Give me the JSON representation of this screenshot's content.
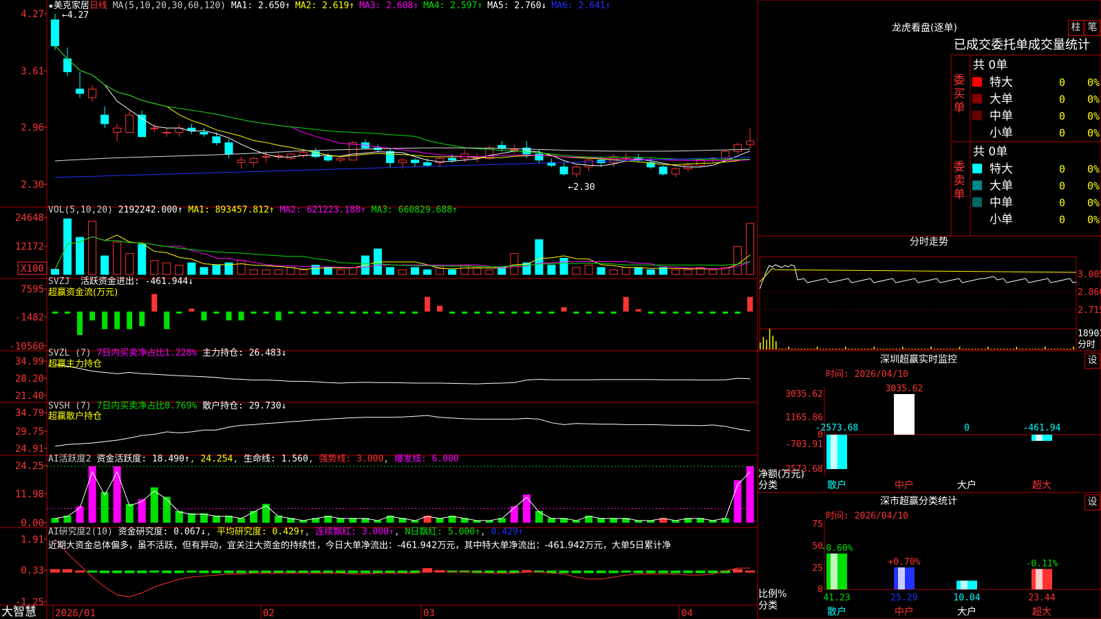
{
  "colors": {
    "up": "#ff3333",
    "down": "#00ffff",
    "grid": "#b00000",
    "yellow": "#ffff00",
    "magenta": "#ff00ff",
    "green": "#00e000",
    "white": "#ffffff",
    "blue": "#2233ff"
  },
  "stock": {
    "name": "美克家居",
    "period": "日线",
    "ma_set": "MA(5,10,20,30,60,120)"
  },
  "header_ma": [
    {
      "label": "MA1:",
      "value": "2.650↑",
      "color": "#ffffff"
    },
    {
      "label": "MA2:",
      "value": "2.619↑",
      "color": "#ffff00"
    },
    {
      "label": "MA3:",
      "value": "2.608↑",
      "color": "#ff00ff"
    },
    {
      "label": "MA4:",
      "value": "2.597↑",
      "color": "#00e000"
    },
    {
      "label": "MA5:",
      "value": "2.760↓",
      "color": "#ffffff"
    },
    {
      "label": "MA6:",
      "value": "2.641↑",
      "color": "#2233ff"
    }
  ],
  "price_axis": [
    "4.27",
    "3.61",
    "2.96",
    "2.30"
  ],
  "price_marks": {
    "high": "4.27",
    "low": "2.30"
  },
  "vol": {
    "title": "VOL(5,10,20)",
    "value": "2192242.000↑",
    "ma1": "MA1: 893457.812↑",
    "ma2": "MA2: 621223.188↑",
    "ma3": "MA3: 660829.688↑",
    "axis": [
      "24648",
      "12172"
    ],
    "unit": "X100"
  },
  "svzj": {
    "title": "SVZJ",
    "line": "活跃资金进出: -461.944↓",
    "sub": "超赢资金流(万元)",
    "axis": [
      "7595",
      "-1482",
      "-10560"
    ]
  },
  "svzl": {
    "title": "SVZL (7)",
    "pct": "7日内买卖净占比1.228%",
    "line": "主力持仓: 26.483↓",
    "sub": "超赢主力持仓",
    "axis": [
      "34.99",
      "28.20",
      "21.40"
    ]
  },
  "svsh": {
    "title": "SVSH (7)",
    "pct": "7日内买卖净占比0.769%",
    "line": "散户持仓: 29.730↓",
    "sub": "超赢散户持仓",
    "axis": [
      "34.79",
      "29.75",
      "24.91"
    ]
  },
  "ai1": {
    "title": "AI活跃度2",
    "a": "资金活跃度: 18.490↑",
    "b": "24.254",
    "c": "生命线: 1.560",
    "d": "强势线: 3.000",
    "e": "爆发线: 6.000",
    "axis": [
      "24.25",
      "11.98",
      "0.00"
    ]
  },
  "ai2": {
    "title": "AI研究度2(10)",
    "a": "资金研究度: 0.067↓",
    "b": "平均研究度: 0.429↑",
    "c": "连续飘红: 3.000↑",
    "d": "N日飘红: 5.000↑",
    "e": "0.429↑",
    "axis": [
      "1.91",
      "0.33",
      "-1.25"
    ],
    "comment": "近期大资金总体偏多，虽不活跃，但有异动，宜关注大资金的持续性，今日大单净流出：-461.942万元，其中特大单净流出：-461.942万元，大单5日累计净"
  },
  "time_axis": [
    "2026/01",
    "02",
    "03",
    "04"
  ],
  "brand": "大智慧",
  "dragon": {
    "title": "龙虎看盘(逐单)",
    "btn1": "柱",
    "btn2": "笔",
    "subtitle": "已成交委托单成交量统计",
    "buy": {
      "label": "委买单",
      "total": "共 0单",
      "rows": [
        {
          "name": "特大",
          "v": "0",
          "p": "0%",
          "c": "#ff0000"
        },
        {
          "name": "大单",
          "v": "0",
          "p": "0%",
          "c": "#880000"
        },
        {
          "name": "中单",
          "v": "0",
          "p": "0%",
          "c": "#660000"
        },
        {
          "name": "小单",
          "v": "0",
          "p": "0%",
          "c": ""
        }
      ]
    },
    "sell": {
      "label": "委卖单",
      "total": "共 0单",
      "rows": [
        {
          "name": "特大",
          "v": "0",
          "p": "0%",
          "c": "#00ffff"
        },
        {
          "name": "大单",
          "v": "0",
          "p": "0%",
          "c": "#008888"
        },
        {
          "name": "中单",
          "v": "0",
          "p": "0%",
          "c": "#006666"
        },
        {
          "name": "小单",
          "v": "0",
          "p": "0%",
          "c": ""
        }
      ]
    }
  },
  "minute": {
    "title": "分时走势",
    "axis": [
      "3.005",
      "2.860",
      "2.715"
    ],
    "vol_axis": [
      "18901",
      "分时"
    ]
  },
  "sz_monitor": {
    "title": "深圳超赢实时监控",
    "btn": "设",
    "time": "时间: 2026/04/10",
    "axis": [
      "3035.62",
      "1165.86",
      "0",
      "-703.91",
      "-2573.68"
    ],
    "ylabel": "净额(万元)",
    "xlabel": "分类",
    "cats": [
      "散户",
      "中户",
      "大户",
      "超大"
    ],
    "values": [
      "-2573.68",
      "3035.62",
      "0",
      "-461.94"
    ]
  },
  "sz_class": {
    "title": "深市超赢分类统计",
    "btn": "设",
    "time": "时间: 2026/04/10",
    "axis": [
      "75",
      "50",
      "25",
      "0"
    ],
    "ylabel": "比例%",
    "xlabel": "分类",
    "cats": [
      "散户",
      "中户",
      "大户",
      "超大"
    ],
    "values": [
      "41.23",
      "25.29",
      "10.04",
      "23.44"
    ],
    "changes": [
      "-0.60%",
      "+0.70%",
      "",
      "-0.11%"
    ]
  },
  "chart_data": [
    {
      "type": "candlestick",
      "title": "美克家居 日线",
      "series": "MA(5,10,20,30,60,120)",
      "x": [
        "2026/01",
        "02",
        "03",
        "04"
      ],
      "ylim": [
        2.3,
        4.27
      ],
      "high": 4.27,
      "low": 2.3,
      "ohlc_approx": [
        [
          4.2,
          4.27,
          3.85,
          3.9
        ],
        [
          3.75,
          3.88,
          3.55,
          3.6
        ],
        [
          3.4,
          3.6,
          3.3,
          3.35
        ],
        [
          3.3,
          3.45,
          3.25,
          3.4
        ],
        [
          3.1,
          3.2,
          2.95,
          3.0
        ],
        [
          2.9,
          3.0,
          2.8,
          2.95
        ],
        [
          2.9,
          3.15,
          2.9,
          3.1
        ],
        [
          3.1,
          3.15,
          2.85,
          2.85
        ],
        [
          2.95,
          3.0,
          2.9,
          2.95
        ],
        [
          2.9,
          2.95,
          2.85,
          2.9
        ],
        [
          2.9,
          3.0,
          2.85,
          2.95
        ],
        [
          2.95,
          3.0,
          2.88,
          2.92
        ],
        [
          2.9,
          2.95,
          2.85,
          2.88
        ],
        [
          2.85,
          2.9,
          2.75,
          2.78
        ],
        [
          2.78,
          2.82,
          2.6,
          2.65
        ],
        [
          2.55,
          2.62,
          2.48,
          2.58
        ],
        [
          2.55,
          2.62,
          2.5,
          2.6
        ],
        [
          2.62,
          2.68,
          2.55,
          2.62
        ],
        [
          2.62,
          2.66,
          2.58,
          2.63
        ],
        [
          2.6,
          2.66,
          2.58,
          2.65
        ],
        [
          2.63,
          2.7,
          2.6,
          2.67
        ],
        [
          2.68,
          2.72,
          2.6,
          2.62
        ],
        [
          2.62,
          2.66,
          2.56,
          2.58
        ],
        [
          2.58,
          2.62,
          2.55,
          2.6
        ],
        [
          2.58,
          2.8,
          2.58,
          2.78
        ],
        [
          2.78,
          2.82,
          2.7,
          2.72
        ],
        [
          2.72,
          2.76,
          2.68,
          2.7
        ],
        [
          2.68,
          2.72,
          2.5,
          2.55
        ],
        [
          2.55,
          2.6,
          2.48,
          2.58
        ],
        [
          2.58,
          2.6,
          2.5,
          2.55
        ],
        [
          2.55,
          2.6,
          2.5,
          2.52
        ],
        [
          2.55,
          2.62,
          2.5,
          2.6
        ],
        [
          2.6,
          2.65,
          2.55,
          2.58
        ],
        [
          2.6,
          2.7,
          2.55,
          2.65
        ],
        [
          2.6,
          2.66,
          2.55,
          2.62
        ],
        [
          2.6,
          2.75,
          2.58,
          2.72
        ],
        [
          2.75,
          2.8,
          2.68,
          2.72
        ],
        [
          2.7,
          2.76,
          2.66,
          2.7
        ],
        [
          2.72,
          2.8,
          2.6,
          2.65
        ],
        [
          2.65,
          2.7,
          2.55,
          2.58
        ],
        [
          2.55,
          2.6,
          2.5,
          2.52
        ],
        [
          2.5,
          2.55,
          2.4,
          2.42
        ],
        [
          2.42,
          2.52,
          2.38,
          2.5
        ],
        [
          2.5,
          2.6,
          2.45,
          2.58
        ],
        [
          2.58,
          2.62,
          2.5,
          2.55
        ],
        [
          2.55,
          2.65,
          2.5,
          2.62
        ],
        [
          2.6,
          2.66,
          2.55,
          2.6
        ],
        [
          2.6,
          2.65,
          2.55,
          2.58
        ],
        [
          2.55,
          2.6,
          2.48,
          2.5
        ],
        [
          2.5,
          2.52,
          2.4,
          2.42
        ],
        [
          2.42,
          2.5,
          2.38,
          2.48
        ],
        [
          2.48,
          2.55,
          2.45,
          2.52
        ],
        [
          2.52,
          2.6,
          2.5,
          2.58
        ],
        [
          2.6,
          2.62,
          2.55,
          2.6
        ],
        [
          2.6,
          2.7,
          2.58,
          2.68
        ],
        [
          2.68,
          2.78,
          2.65,
          2.76
        ],
        [
          2.76,
          2.95,
          2.72,
          2.8
        ]
      ]
    }
  ]
}
